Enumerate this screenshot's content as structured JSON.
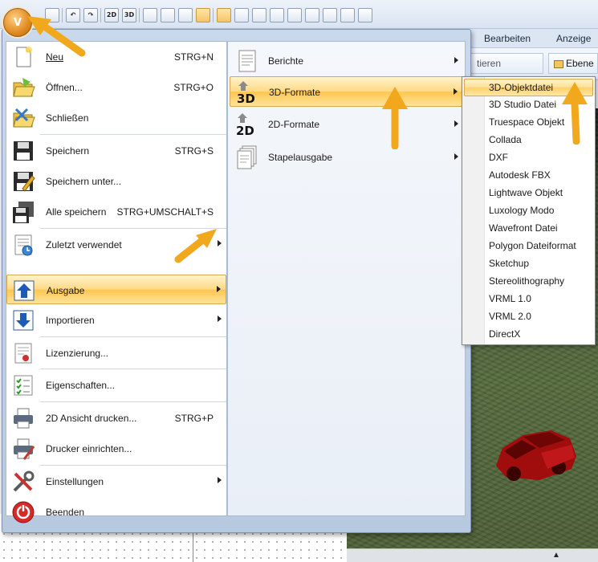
{
  "quick_access": {
    "orb_text": "V",
    "buttons": [
      {
        "name": "new-doc-icon",
        "label": ""
      },
      {
        "name": "undo-icon",
        "label": "↶"
      },
      {
        "name": "redo-icon",
        "label": "↷"
      },
      {
        "name": "view-2d-icon",
        "label": "2D"
      },
      {
        "name": "view-3d-icon",
        "label": "3D"
      },
      {
        "name": "horizontal-split-icon",
        "label": ""
      },
      {
        "name": "vertical-split-icon",
        "label": ""
      },
      {
        "name": "grid-icon",
        "label": ""
      },
      {
        "name": "magnet-icon",
        "label": ""
      },
      {
        "name": "cursor-snap-icon",
        "label": ""
      },
      {
        "name": "columns-icon",
        "label": ""
      },
      {
        "name": "crosshair-icon",
        "label": ""
      },
      {
        "name": "pointer-icon",
        "label": ""
      },
      {
        "name": "resize-icon",
        "label": ""
      },
      {
        "name": "corner-icon",
        "label": ""
      },
      {
        "name": "corner-alt-icon",
        "label": ""
      },
      {
        "name": "eraser-icon",
        "label": ""
      },
      {
        "name": "copy-icon",
        "label": ""
      }
    ]
  },
  "ribbon": {
    "tabs": [
      "Bearbeiten",
      "Anzeige"
    ],
    "button_1": "tieren",
    "button_2": "Ebene"
  },
  "app_menu": {
    "items": [
      {
        "label": "Neu",
        "shortcut": "STRG+N"
      },
      {
        "label": "Öffnen...",
        "shortcut": "STRG+O"
      },
      {
        "label": "Schließen",
        "shortcut": ""
      },
      {
        "label": "Speichern",
        "shortcut": "STRG+S"
      },
      {
        "label": "Speichern unter...",
        "shortcut": ""
      },
      {
        "label": "Alle speichern",
        "shortcut": "STRG+UMSCHALT+S"
      },
      {
        "label": "Zuletzt verwendet",
        "shortcut": ""
      },
      {
        "label": "Ausgabe",
        "shortcut": ""
      },
      {
        "label": "Importieren",
        "shortcut": ""
      },
      {
        "label": "Lizenzierung...",
        "shortcut": ""
      },
      {
        "label": "Eigenschaften...",
        "shortcut": ""
      },
      {
        "label": "2D Ansicht drucken...",
        "shortcut": "STRG+P"
      },
      {
        "label": "Drucker einrichten...",
        "shortcut": ""
      },
      {
        "label": "Einstellungen",
        "shortcut": ""
      },
      {
        "label": "Beenden",
        "shortcut": ""
      }
    ]
  },
  "output_submenu": {
    "items": [
      {
        "label": "Berichte"
      },
      {
        "label": "3D-Formate"
      },
      {
        "label": "2D-Formate"
      },
      {
        "label": "Stapelausgabe"
      }
    ]
  },
  "formats_submenu": {
    "items": [
      "3D-Objektdatei",
      "3D Studio Datei",
      "Truespace Objekt",
      "Collada",
      "DXF",
      "Autodesk FBX",
      "Lightwave Objekt",
      "Luxology Modo",
      "Wavefront Datei",
      "Polygon Dateiformat",
      "Sketchup",
      "Stereolithography",
      "VRML 1.0",
      "VRML 2.0",
      "DirectX"
    ]
  },
  "colors": {
    "highlight": "#ffc64f",
    "annotation_arrow": "#f2a81d"
  }
}
